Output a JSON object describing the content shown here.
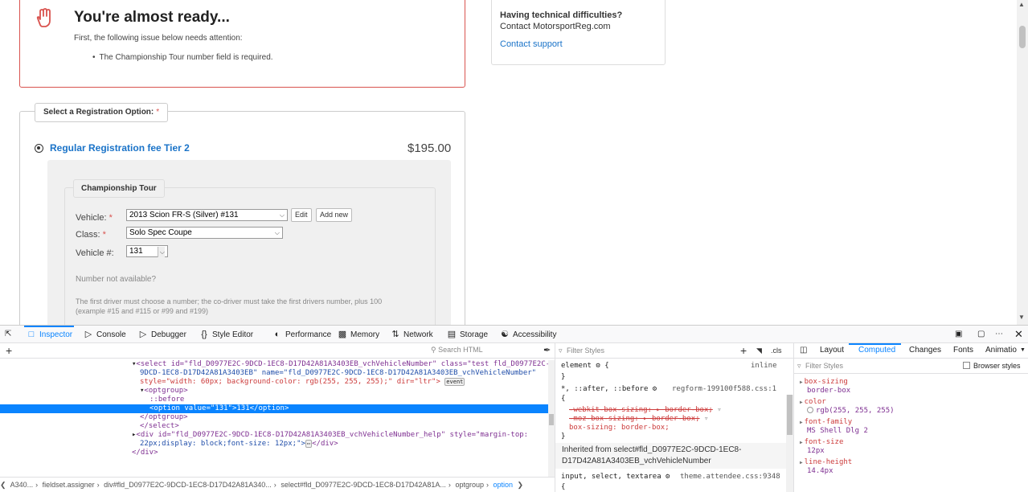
{
  "page": {
    "error": {
      "title": "You're almost ready...",
      "subtitle": "First, the following issue below needs attention:",
      "item": "The Championship Tour number field is required."
    },
    "support": {
      "question": "Having technical difficulties?",
      "contact": "Contact MotorsportReg.com",
      "link": "Contact support"
    },
    "registration": {
      "legend": "Select a Registration Option:",
      "required": "*",
      "option_label": "Regular Registration fee Tier 2",
      "price": "$195.00"
    },
    "championship": {
      "legend": "Championship Tour",
      "vehicle_label": "Vehicle:",
      "vehicle_value": "2013 Scion FR-S (Silver) #131",
      "edit": "Edit",
      "add_new": "Add new",
      "class_label": "Class:",
      "class_value": "Solo Spec Coupe",
      "number_label": "Vehicle #:",
      "number_value": "131",
      "not_available": "Number not available?",
      "help_line1": "The first driver must choose a number; the co-driver must take the first drivers number, plus 100",
      "help_line2": "(example #15 and #115 or #99 and #199)"
    }
  },
  "devtools": {
    "tabs": [
      "Inspector",
      "Console",
      "Debugger",
      "Style Editor",
      "Performance",
      "Memory",
      "Network",
      "Storage",
      "Accessibility"
    ],
    "search_placeholder": "Search HTML",
    "code": {
      "l1": "<select id=\"fld_D0977E2C-9DCD-1EC8-D17D42A81A3403EB_vchVehicleNumber\" class=\"test fld_D0977E2C-",
      "l2": "9DCD-1EC8-D17D42A81A3403EB\" name=\"fld_D0977E2C-9DCD-1EC8-D17D42A81A3403EB_vchVehicleNumber\"",
      "l3": "style=\"width: 60px; background-color: rgb(255, 255, 255);\" dir=\"ltr\">",
      "l3_badge": "event",
      "l4": "<optgroup>",
      "l5": "::before",
      "l6": "<option value=\"131\">131</option>",
      "l7": "</optgroup>",
      "l8": "</select>",
      "l9": "<div id=\"fld_D0977E2C-9DCD-1EC8-D17D42A81A3403EB_vchVehicleNumber_help\" style=\"margin-top:",
      "l10": "22px;display: block;font-size: 12px;\">",
      "l10_tail": "</div>",
      "l11": "</div>"
    },
    "breadcrumbs": [
      "A340...",
      "fieldset.assigner",
      "div#fld_D0977E2C-9DCD-1EC8-D17D42A81A340...",
      "select#fld_D0977E2C-9DCD-1EC8-D17D42A81A...",
      "optgroup",
      "option"
    ],
    "rules": {
      "filter_placeholder": "Filter Styles",
      "cls": ".cls",
      "element_sel": "element",
      "element_src": "inline",
      "brace_open": "{",
      "brace_close": "}",
      "universal_sel": "*, ::after, ::before",
      "universal_src": "regform-199100f588.css:1",
      "decl1": "-webkit-box-sizing: ▸ border-box;",
      "decl2": "-moz-box-sizing: ▸ border-box;",
      "decl3": "box-sizing: border-box;",
      "inherited": "Inherited from select#fld_D0977E2C-9DCD-1EC8-D17D42A81A3403EB_vchVehicleNumber",
      "input_sel": "input, select, textarea",
      "input_src": "theme.attendee.css:9348"
    },
    "computed": {
      "tabs": [
        "Layout",
        "Computed",
        "Changes",
        "Fonts",
        "Animatio"
      ],
      "filter_placeholder": "Filter Styles",
      "browser_styles": "Browser styles",
      "props": [
        {
          "name": "box-sizing",
          "value": "border-box"
        },
        {
          "name": "color",
          "value": "rgb(255, 255, 255)"
        },
        {
          "name": "font-family",
          "value": "MS Shell Dlg 2"
        },
        {
          "name": "font-size",
          "value": "12px"
        },
        {
          "name": "line-height",
          "value": "14.4px"
        }
      ]
    }
  }
}
